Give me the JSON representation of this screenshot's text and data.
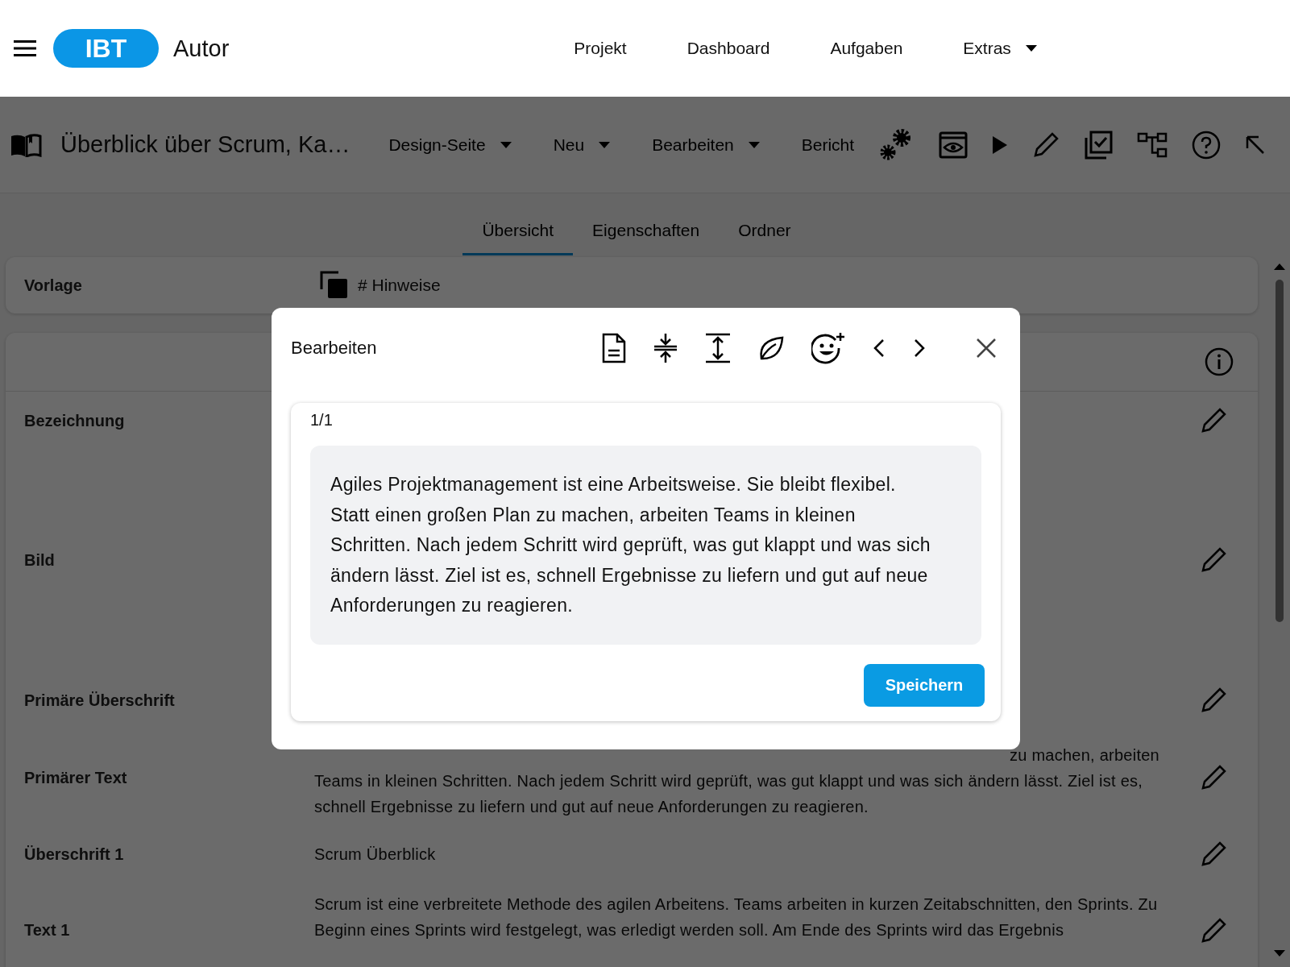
{
  "header": {
    "brand": "IBT",
    "title": "Autor",
    "nav": [
      {
        "label": "Projekt",
        "dropdown": false
      },
      {
        "label": "Dashboard",
        "dropdown": false
      },
      {
        "label": "Aufgaben",
        "dropdown": false
      },
      {
        "label": "Extras",
        "dropdown": true
      }
    ]
  },
  "toolbar": {
    "title": "Überblick über Scrum, Ka…",
    "menus": [
      "Design-Seite",
      "Neu",
      "Bearbeiten"
    ],
    "report": "Bericht"
  },
  "tabs": [
    {
      "label": "Übersicht",
      "selected": true
    },
    {
      "label": "Eigenschaften",
      "selected": false
    },
    {
      "label": "Ordner",
      "selected": false
    }
  ],
  "template": {
    "label": "Vorlage",
    "value": "# Hinweise"
  },
  "fields": [
    {
      "label": "Bezeichnung"
    },
    {
      "label": "Bild"
    },
    {
      "label": "Primäre Überschrift"
    },
    {
      "label": "Primärer Text",
      "cut_line": "zu machen, arbeiten",
      "value": "Teams in kleinen Schritten. Nach jedem Schritt wird geprüft, was gut klappt und was sich ändern lässt. Ziel ist es, schnell Ergebnisse zu liefern und gut auf neue Anforderungen zu reagieren."
    },
    {
      "label": "Überschrift 1",
      "value": "Scrum Überblick"
    },
    {
      "label": "Text 1",
      "value": "Scrum ist eine verbreitete Methode des agilen Arbeitens. Teams arbeiten in kurzen Zeitabschnitten, den Sprints. Zu Beginn eines Sprints wird festgelegt, was erledigt werden soll. Am Ende des Sprints wird das Ergebnis"
    }
  ],
  "dialog": {
    "title": "Bearbeiten",
    "counter": "1/1",
    "text": "Agiles Projektmanagement ist eine Arbeitsweise. Sie bleibt flexibel. Statt einen großen Plan zu machen, arbeiten Teams in kleinen Schritten. Nach jedem Schritt wird geprüft, was gut klappt und was sich ändern lässt. Ziel ist es, schnell Ergebnisse zu liefern und gut auf neue Anforderungen zu reagieren.",
    "save": "Speichern"
  }
}
